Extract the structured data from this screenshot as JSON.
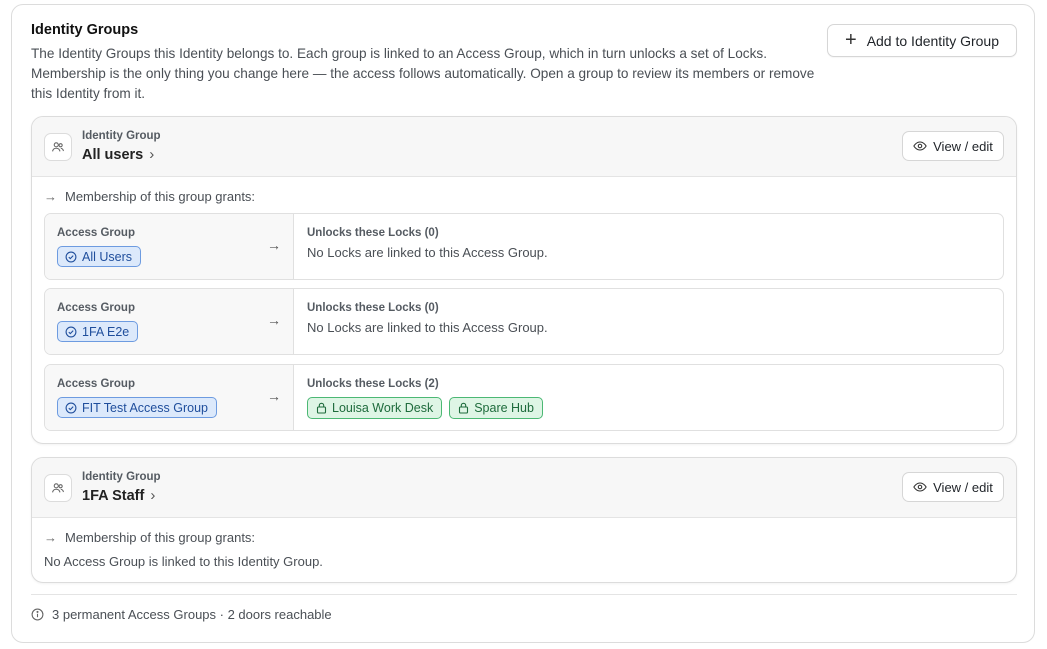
{
  "section": {
    "title": "Identity Groups",
    "description": "The Identity Groups this Identity belongs to. Each group is linked to an Access Group, which in turn unlocks a set of Locks. Membership is the only thing you change here — the access follows automatically. Open a group to review its members or remove this Identity from it.",
    "add_button_label": "Add to Identity Group"
  },
  "groups": [
    {
      "kicker": "Identity Group",
      "name": "All users",
      "view_label": "View / edit",
      "grants_label": "Membership of this group grants:",
      "access_groups": [
        {
          "kicker": "Access Group",
          "name": "All Users",
          "locks_title": "Unlocks these Locks (0)",
          "empty_text": "No Locks are linked to this Access Group.",
          "locks": []
        },
        {
          "kicker": "Access Group",
          "name": "1FA E2e",
          "locks_title": "Unlocks these Locks (0)",
          "empty_text": "No Locks are linked to this Access Group.",
          "locks": []
        },
        {
          "kicker": "Access Group",
          "name": "FIT Test Access Group",
          "locks_title": "Unlocks these Locks (2)",
          "empty_text": "",
          "locks": [
            "Louisa Work Desk",
            "Spare Hub"
          ]
        }
      ]
    },
    {
      "kicker": "Identity Group",
      "name": "1FA Staff",
      "view_label": "View / edit",
      "grants_label": "Membership of this group grants:",
      "no_access_text": "No Access Group is linked to this Identity Group."
    }
  ],
  "footer": {
    "summary": "3 permanent Access Groups · 2 doors reachable"
  },
  "icons": {
    "add": "plus-icon",
    "group": "users-icon",
    "view": "eye-icon",
    "access_group": "check-circle-icon",
    "lock": "lock-icon",
    "info": "info-icon"
  },
  "colors": {
    "access_pill_bg": "#dce9fb",
    "access_pill_border": "#6d9be0",
    "lock_pill_bg": "#def5e5",
    "lock_pill_border": "#4cb874"
  }
}
